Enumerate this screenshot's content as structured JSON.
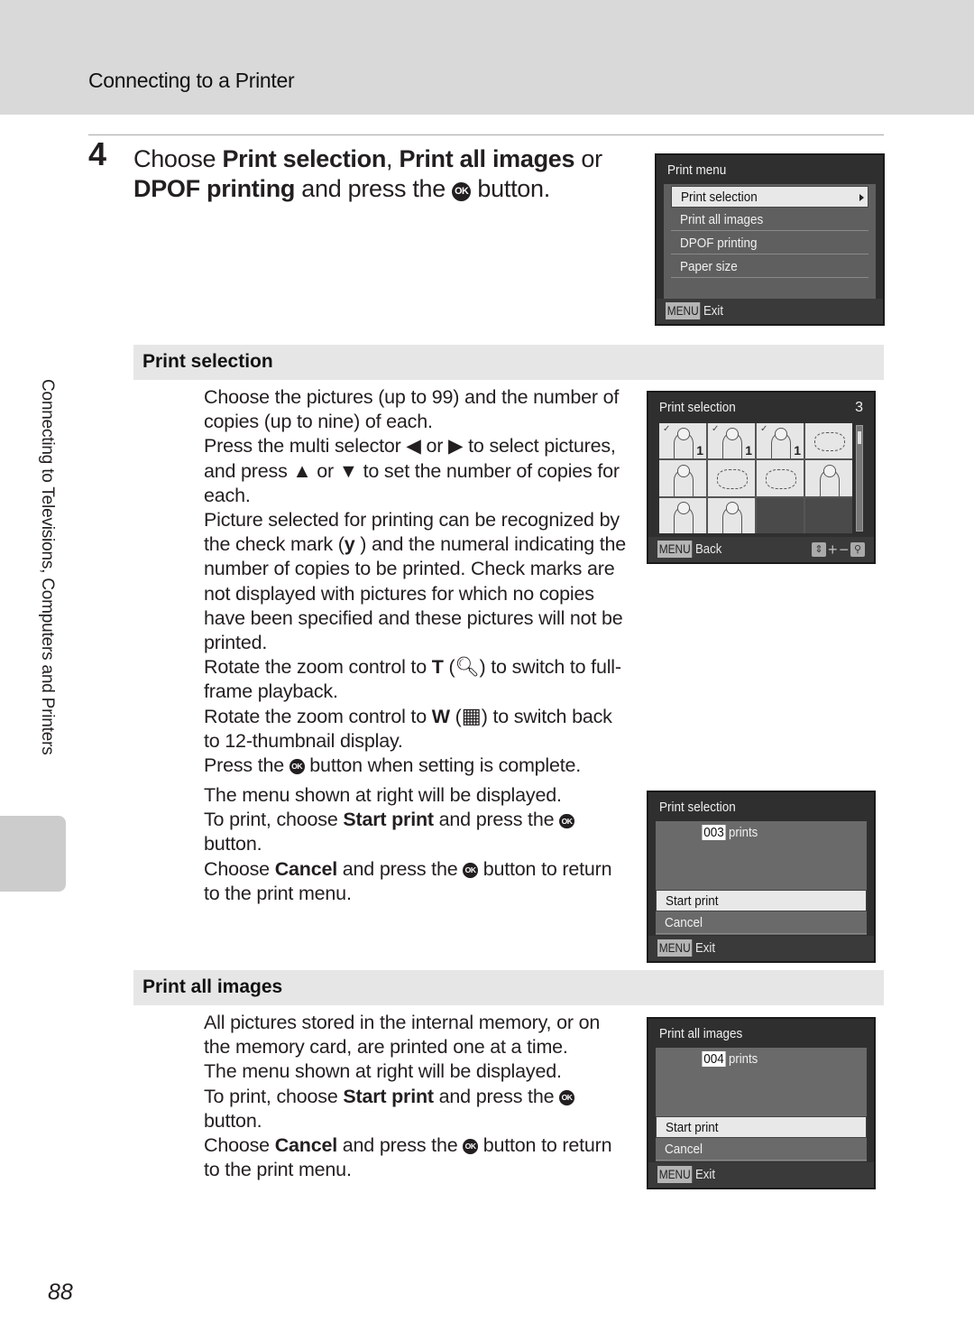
{
  "header": {
    "title": "Connecting to a Printer"
  },
  "step": {
    "number": "4",
    "parts": [
      {
        "text": "Choose ",
        "bold": false
      },
      {
        "text": "Print selection",
        "bold": true
      },
      {
        "text": ", ",
        "bold": false
      },
      {
        "text": "Print all images",
        "bold": true
      },
      {
        "text": " or ",
        "bold": false
      },
      {
        "text": "DPOF printing",
        "bold": true
      },
      {
        "text": " and press the ",
        "bold": false
      },
      {
        "text": "OK",
        "icon": "ok-button-icon"
      },
      {
        "text": " button.",
        "bold": false
      }
    ]
  },
  "print_menu_screen": {
    "title": "Print menu",
    "items": [
      "Print selection",
      "Print all images",
      "DPOF printing",
      "Paper size"
    ],
    "selected_index": 0,
    "menu_badge": "MENU",
    "footer_label": "Exit"
  },
  "section_print_selection": {
    "heading": "Print selection",
    "paragraphs": [
      [
        {
          "t": "Choose the pictures (up to 99) and the number of copies (up to nine) of each."
        }
      ],
      [
        {
          "t": "Press the multi selector "
        },
        {
          "icon": "left-arrow-icon",
          "g": "◀"
        },
        {
          "t": " or "
        },
        {
          "icon": "right-arrow-icon",
          "g": "▶"
        },
        {
          "t": " to select pictures, and press "
        },
        {
          "icon": "up-arrow-icon",
          "g": "▲"
        },
        {
          "t": " or "
        },
        {
          "icon": "down-arrow-icon",
          "g": "▼"
        },
        {
          "t": " to set the number of copies for each."
        }
      ],
      [
        {
          "t": "Picture selected for printing can be recognized by the check mark ("
        },
        {
          "b": "y"
        },
        {
          "t": "    ) and the numeral indicating the number of copies to be printed. Check marks are not displayed with pictures for which no copies have been specified and these pictures will not be printed."
        }
      ],
      [
        {
          "t": "Rotate the zoom control to "
        },
        {
          "b": "T"
        },
        {
          "t": " ("
        },
        {
          "icon": "magnify-icon",
          "g": "🔍︎"
        },
        {
          "t": ") to switch to full-frame playback."
        }
      ],
      [
        {
          "t": "Rotate the zoom control to "
        },
        {
          "b": "W"
        },
        {
          "t": " ("
        },
        {
          "icon": "thumbnail-icon",
          "g": "▦"
        },
        {
          "t": ") to switch back to 12-thumbnail display."
        }
      ],
      [
        {
          "t": "Press the "
        },
        {
          "icon": "ok-button-icon",
          "g": "OK"
        },
        {
          "t": " button when setting is complete."
        }
      ]
    ],
    "paragraphs2": [
      [
        {
          "t": "The menu shown at right will be displayed."
        }
      ],
      [
        {
          "t": "To print, choose "
        },
        {
          "b": "Start print"
        },
        {
          "t": " and press the "
        },
        {
          "icon": "ok-button-icon",
          "g": "OK"
        },
        {
          "t": " button."
        }
      ],
      [
        {
          "t": "Choose "
        },
        {
          "b": "Cancel"
        },
        {
          "t": " and press the "
        },
        {
          "icon": "ok-button-icon",
          "g": "OK"
        },
        {
          "t": " button to return to the print menu."
        }
      ]
    ],
    "thumb_screen": {
      "title": "Print selection",
      "count": "3",
      "thumbnails": [
        {
          "type": "portrait",
          "checked": true,
          "copies": "1"
        },
        {
          "type": "portrait",
          "checked": true,
          "copies": "1"
        },
        {
          "type": "family",
          "checked": true,
          "copies": "1"
        },
        {
          "type": "flowers",
          "checked": false,
          "copies": ""
        },
        {
          "type": "portrait",
          "checked": false,
          "copies": ""
        },
        {
          "type": "flowers",
          "checked": false,
          "copies": ""
        },
        {
          "type": "flowers",
          "checked": false,
          "copies": ""
        },
        {
          "type": "portrait",
          "checked": false,
          "copies": ""
        },
        {
          "type": "portrait",
          "checked": false,
          "copies": ""
        },
        {
          "type": "family",
          "checked": false,
          "copies": ""
        },
        {
          "type": "empty"
        },
        {
          "type": "empty"
        }
      ],
      "menu_badge": "MENU",
      "footer_label": "Back",
      "controls": [
        "up-down-icon",
        "plus-icon",
        "minus-icon",
        "zoom-icon"
      ]
    },
    "confirm_screen": {
      "title": "Print selection",
      "prints_count": "003",
      "prints_label": "prints",
      "options": [
        "Start print",
        "Cancel"
      ],
      "selected_index": 0,
      "menu_badge": "MENU",
      "footer_label": "Exit"
    }
  },
  "section_print_all": {
    "heading": "Print all images",
    "paragraphs": [
      [
        {
          "t": "All pictures stored in the internal memory, or on the memory card, are printed one at a time."
        }
      ],
      [
        {
          "t": "The menu shown at right will be displayed."
        }
      ],
      [
        {
          "t": "To print, choose "
        },
        {
          "b": "Start print"
        },
        {
          "t": " and press the "
        },
        {
          "icon": "ok-button-icon",
          "g": "OK"
        },
        {
          "t": " button."
        }
      ],
      [
        {
          "t": "Choose "
        },
        {
          "b": "Cancel"
        },
        {
          "t": " and press the "
        },
        {
          "icon": "ok-button-icon",
          "g": "OK"
        },
        {
          "t": " button to return to the print menu."
        }
      ]
    ],
    "confirm_screen": {
      "title": "Print all images",
      "prints_count": "004",
      "prints_label": "prints",
      "options": [
        "Start print",
        "Cancel"
      ],
      "selected_index": 0,
      "menu_badge": "MENU",
      "footer_label": "Exit"
    }
  },
  "side_tab": {
    "label": "Connecting to Televisions, Computers and Printers"
  },
  "page_number": "88"
}
